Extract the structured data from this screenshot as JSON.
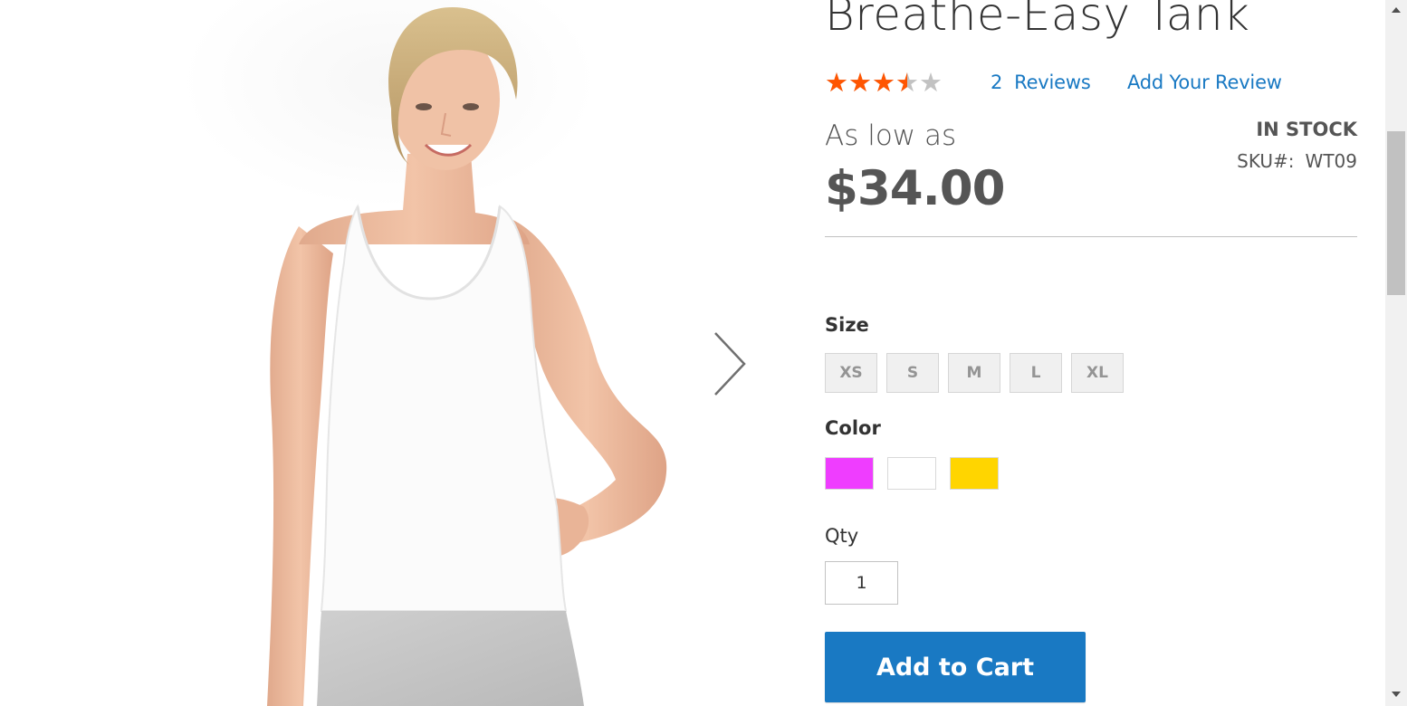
{
  "product": {
    "title": "Breathe-Easy Tank",
    "rating": {
      "stars": 3.5,
      "max": 5,
      "reviews_label": "Reviews",
      "reviews_count": "2",
      "add_review_label": "Add Your Review"
    },
    "price": {
      "prefix": "As low as",
      "amount": "$34.00"
    },
    "stock": "IN STOCK",
    "sku": {
      "label": "SKU#:",
      "value": "WT09"
    }
  },
  "options": {
    "size_label": "Size",
    "sizes": [
      "XS",
      "S",
      "M",
      "L",
      "XL"
    ],
    "color_label": "Color",
    "colors": [
      {
        "name": "Purple",
        "hex": "#ef3dff"
      },
      {
        "name": "White",
        "hex": "#ffffff"
      },
      {
        "name": "Yellow",
        "hex": "#ffd500"
      }
    ]
  },
  "qty": {
    "label": "Qty",
    "value": "1"
  },
  "actions": {
    "add_to_cart": "Add to Cart"
  },
  "colors": {
    "link": "#1979c3",
    "button": "#1979c3",
    "star_filled": "#ff5501",
    "star_empty": "#c2c2c2"
  },
  "gallery": {
    "next_icon": "chevron-right-icon"
  }
}
